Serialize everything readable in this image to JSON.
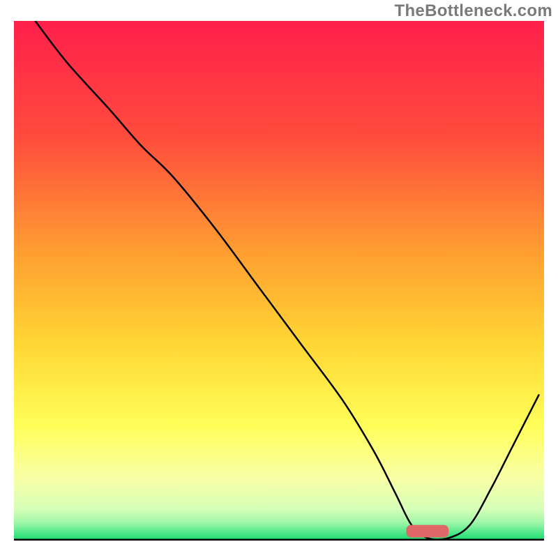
{
  "watermark": "TheBottleneck.com",
  "chart_data": {
    "type": "line",
    "title": "",
    "xlabel": "",
    "ylabel": "",
    "xlim": [
      0,
      100
    ],
    "ylim": [
      0,
      100
    ],
    "grid": false,
    "legend": false,
    "gradient_stops": [
      {
        "offset": 0.0,
        "color": "#ff1f4b"
      },
      {
        "offset": 0.22,
        "color": "#ff4b3d"
      },
      {
        "offset": 0.45,
        "color": "#ffa031"
      },
      {
        "offset": 0.62,
        "color": "#ffd634"
      },
      {
        "offset": 0.78,
        "color": "#ffff5a"
      },
      {
        "offset": 0.88,
        "color": "#f8ffa6"
      },
      {
        "offset": 0.94,
        "color": "#d6ffb8"
      },
      {
        "offset": 0.965,
        "color": "#a0f7a8"
      },
      {
        "offset": 0.985,
        "color": "#4fe88a"
      },
      {
        "offset": 1.0,
        "color": "#17d96f"
      }
    ],
    "series": [
      {
        "name": "bottleneck-curve",
        "color": "#000000",
        "stroke_width": 2.5,
        "x": [
          4,
          10,
          18,
          24,
          30,
          38,
          46,
          54,
          62,
          68,
          72,
          75,
          78,
          82,
          86,
          90,
          94,
          99
        ],
        "y": [
          100,
          92,
          83,
          76,
          70,
          60,
          49,
          38,
          27,
          17,
          9,
          3,
          0.5,
          0.5,
          3,
          10,
          18,
          28
        ]
      }
    ],
    "marker": {
      "name": "optimal-range",
      "color": "#e06868",
      "x_start": 74,
      "x_end": 82,
      "y": 0.6,
      "height": 2.4
    },
    "axes": {
      "x_visible": true,
      "y_visible": false,
      "x_color": "#000000",
      "x_width": 3
    }
  }
}
